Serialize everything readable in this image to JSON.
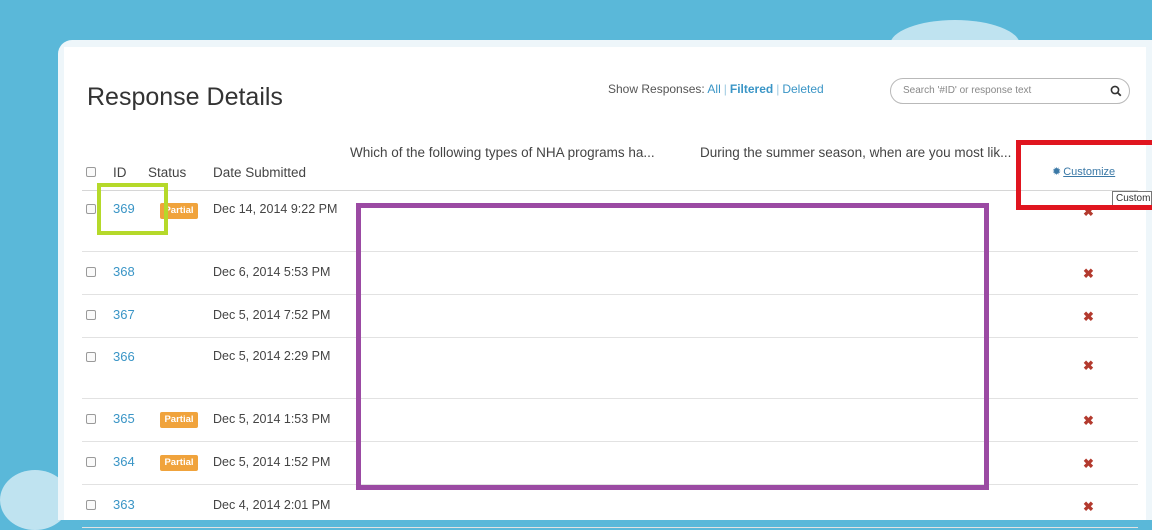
{
  "page": {
    "title": "Response Details",
    "show_responses": {
      "label": "Show Responses:",
      "options": [
        "All",
        "Filtered",
        "Deleted"
      ],
      "selected": "Filtered"
    },
    "search": {
      "placeholder": "Search '#ID' or response text",
      "icon": "search-icon"
    }
  },
  "table": {
    "columns": {
      "id": "ID",
      "status": "Status",
      "date": "Date Submitted",
      "q1": "Which of the following types of NHA programs ha...",
      "q2": "During the summer season, when are you most lik..."
    },
    "customize_label": "Customize",
    "tooltip_text": "Customize",
    "rows": [
      {
        "id": "369",
        "status": "Partial",
        "date": "Dec 14, 2014 9:22 PM"
      },
      {
        "id": "368",
        "status": "",
        "date": "Dec 6, 2014 5:53 PM"
      },
      {
        "id": "367",
        "status": "",
        "date": "Dec 5, 2014 7:52 PM"
      },
      {
        "id": "366",
        "status": "",
        "date": "Dec 5, 2014 2:29 PM"
      },
      {
        "id": "365",
        "status": "Partial",
        "date": "Dec 5, 2014 1:53 PM"
      },
      {
        "id": "364",
        "status": "Partial",
        "date": "Dec 5, 2014 1:52 PM"
      },
      {
        "id": "363",
        "status": "",
        "date": "Dec 4, 2014 2:01 PM"
      }
    ],
    "delete_glyph": "✖"
  },
  "annotations": {
    "colors": {
      "id_box": "#b5d92a",
      "content_box": "#9b4aa3",
      "customize_box": "#e0151f"
    }
  }
}
